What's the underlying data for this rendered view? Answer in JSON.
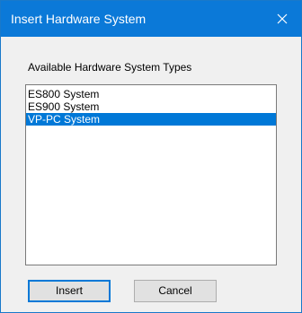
{
  "window": {
    "title": "Insert Hardware System",
    "close_icon": "close-icon"
  },
  "hardware_types": {
    "label": "Available Hardware System Types",
    "items": [
      {
        "label": "ES800 System",
        "selected": false
      },
      {
        "label": "ES900 System",
        "selected": false
      },
      {
        "label": "VP-PC System",
        "selected": true
      }
    ]
  },
  "buttons": {
    "insert_label": "Insert",
    "cancel_label": "Cancel"
  },
  "colors": {
    "titlebar": "#0b79d8",
    "selection": "#0078d7",
    "default_button_border": "#0078d7",
    "dialog_background": "#f0f0f0"
  }
}
